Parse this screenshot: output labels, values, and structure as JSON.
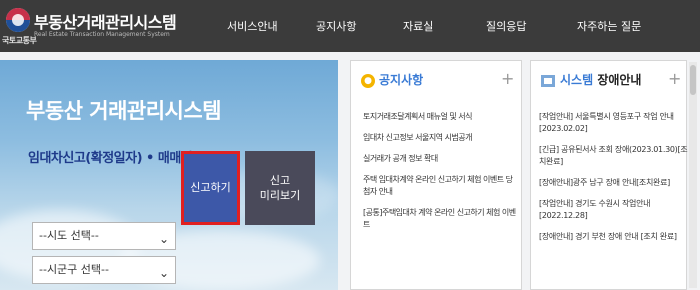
{
  "header": {
    "ministry": "국토교통부",
    "site_title": "부동산거래관리시스템",
    "site_subtitle": "Real Estate Transaction Management System"
  },
  "nav": [
    "서비스안내",
    "공지사항",
    "자료실",
    "질의응답",
    "자주하는 질문"
  ],
  "hero": {
    "title": "부동산 거래관리시스템",
    "subtitle": "임대차신고(확정일자) • 매매신고",
    "select_sido": "--시도 선택--",
    "select_sigungu": "--시군구 선택--",
    "chevron": "⌄",
    "report_button": "신고하기",
    "preview_line1": "신고",
    "preview_line2": "미리보기"
  },
  "notice": {
    "title": "공지사항",
    "plus": "+",
    "items": [
      "토지거래조달계획서 매뉴얼 및 서식",
      "임대차 신고정보 서울지역 시범공개",
      "실거래가 공개 정보 확대",
      "주택 임대차계약 온라인 신고하기 체험 이벤트 당첨자 안내",
      "[공통]주택임대차 계약 온라인 신고하기 체험 이벤트"
    ]
  },
  "outage": {
    "title_prefix": "시스템",
    "title_suffix": "장애안내",
    "plus": "+",
    "items": [
      "[작업안내] 서울특별시 영등포구 작업 안내[2023.02.02]",
      "[긴급] 공유된서사 조회 장애(2023.01.30)[조치완료]",
      "[장애안내]광주 남구 장애 안내[조치완료]",
      "[작업안내] 경기도 수원시 작업안내[2022.12.28]",
      "[장애안내] 경기 부천 장애 안내 [조치 완료]"
    ]
  },
  "colors": {
    "header_bg": "#3b3b3b",
    "report_btn": "#3d58a8",
    "highlight_border": "#e02020",
    "preview_btn": "#4a4a5a",
    "hero_subtitle": "#1e3a8a"
  }
}
